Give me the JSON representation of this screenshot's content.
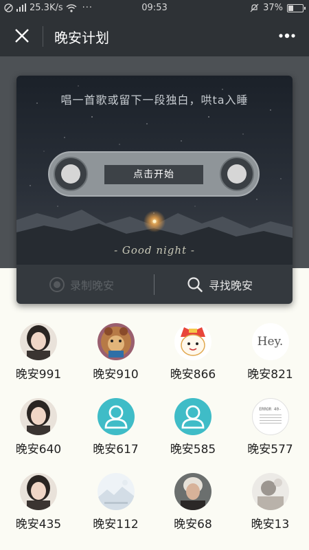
{
  "status_bar": {
    "speed": "25.3K/s",
    "dots": "···",
    "time": "09:53",
    "battery": "37%",
    "battery_level": 0.37
  },
  "header": {
    "title": "晚安计划"
  },
  "card": {
    "headline": "唱一首歌或留下一段独白，哄ta入睡",
    "start_button": "点击开始",
    "good_night": "- Good night -",
    "record_label": "录制晚安",
    "find_label": "寻找晚安"
  },
  "users": [
    {
      "name": "晚安991",
      "avatar": "photo-girl"
    },
    {
      "name": "晚安910",
      "avatar": "cartoon-bear"
    },
    {
      "name": "晚安866",
      "avatar": "cartoon-face"
    },
    {
      "name": "晚安821",
      "avatar": "text-hey"
    },
    {
      "name": "晚安640",
      "avatar": "photo-girl"
    },
    {
      "name": "晚安617",
      "avatar": "default-person"
    },
    {
      "name": "晚安585",
      "avatar": "default-person"
    },
    {
      "name": "晚安577",
      "avatar": "screenshot-error"
    },
    {
      "name": "晚安435",
      "avatar": "photo-girl"
    },
    {
      "name": "晚安112",
      "avatar": "landscape"
    },
    {
      "name": "晚安68",
      "avatar": "photo-man"
    },
    {
      "name": "晚安13",
      "avatar": "photo-blurred"
    }
  ],
  "avatar_texts": {
    "hey": "Hey.",
    "error": "ERROR 40-"
  },
  "colors": {
    "header_bg": "#2e3236",
    "accent": "#3fbcc7",
    "page_bg": "#fbfbf4"
  }
}
